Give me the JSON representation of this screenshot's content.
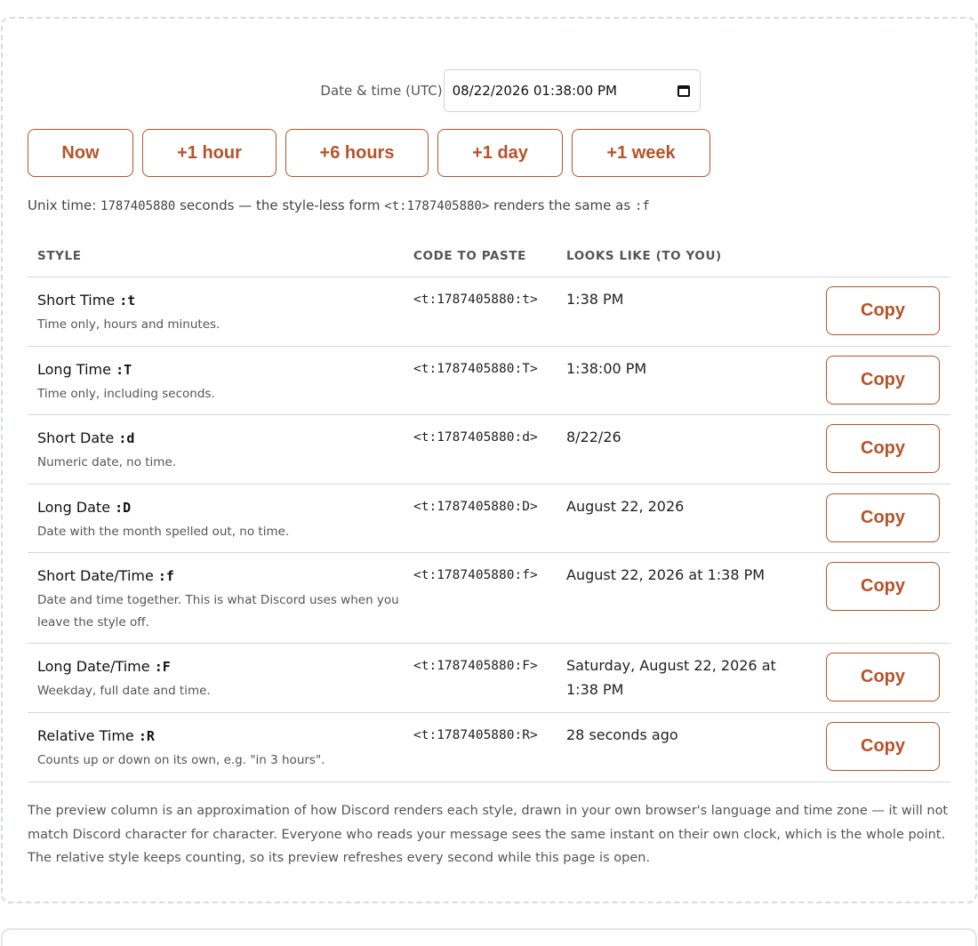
{
  "datetime": {
    "label": "Date & time (UTC)",
    "value": "08/22/2026 01:38:00 PM"
  },
  "quick_buttons": [
    "Now",
    "+1 hour",
    "+6 hours",
    "+1 day",
    "+1 week"
  ],
  "unix": {
    "prefix": "Unix time:",
    "value": "1787405880",
    "middle": "seconds — the style-less form",
    "form": "<t:1787405880>",
    "suffix": "renders the same as",
    "style": ":f"
  },
  "table": {
    "headers": [
      "STYLE",
      "CODE TO PASTE",
      "LOOKS LIKE (TO YOU)"
    ],
    "copy_label": "Copy",
    "rows": [
      {
        "name": "Short Time",
        "flag": ":t",
        "desc": "Time only, hours and minutes.",
        "code": "<t:1787405880:t>",
        "looks": "1:38 PM"
      },
      {
        "name": "Long Time",
        "flag": ":T",
        "desc": "Time only, including seconds.",
        "code": "<t:1787405880:T>",
        "looks": "1:38:00 PM"
      },
      {
        "name": "Short Date",
        "flag": ":d",
        "desc": "Numeric date, no time.",
        "code": "<t:1787405880:d>",
        "looks": "8/22/26"
      },
      {
        "name": "Long Date",
        "flag": ":D",
        "desc": "Date with the month spelled out, no time.",
        "code": "<t:1787405880:D>",
        "looks": "August 22, 2026"
      },
      {
        "name": "Short Date/Time",
        "flag": ":f",
        "desc": "Date and time together. This is what Discord uses when you leave the style off.",
        "code": "<t:1787405880:f>",
        "looks": "August 22, 2026 at 1:38 PM"
      },
      {
        "name": "Long Date/Time",
        "flag": ":F",
        "desc": "Weekday, full date and time.",
        "code": "<t:1787405880:F>",
        "looks": "Saturday, August 22, 2026 at 1:38 PM"
      },
      {
        "name": "Relative Time",
        "flag": ":R",
        "desc": "Counts up or down on its own, e.g. \"in 3 hours\".",
        "code": "<t:1787405880:R>",
        "looks": "28 seconds ago"
      }
    ]
  },
  "footnote": "The preview column is an approximation of how Discord renders each style, drawn in your own browser's language and time zone — it will not match Discord character for character. Everyone who reads your message sees the same instant on their own clock, which is the whole point. The relative style keeps counting, so its preview refreshes every second while this page is open."
}
